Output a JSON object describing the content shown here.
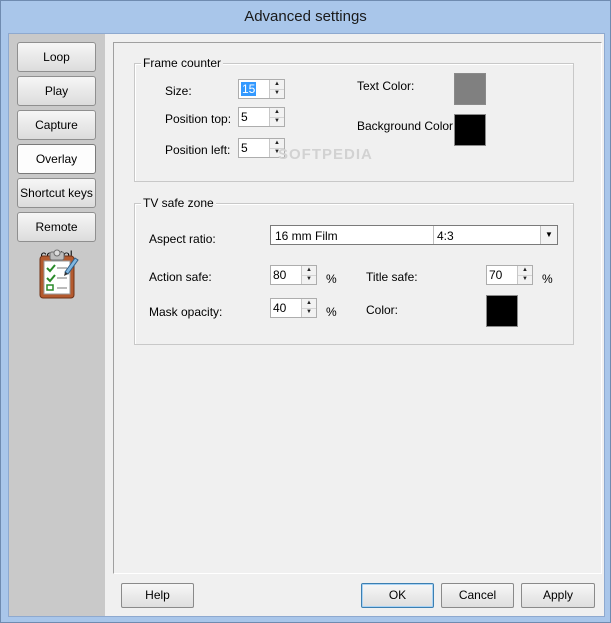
{
  "window": {
    "title": "Advanced settings"
  },
  "nav": {
    "items": [
      {
        "label": "Loop"
      },
      {
        "label": "Play"
      },
      {
        "label": "Capture"
      },
      {
        "label": "Overlay",
        "active": true
      },
      {
        "label": "Shortcut keys"
      },
      {
        "label": "Remote contol"
      }
    ],
    "icon": "clipboard-checklist-icon"
  },
  "frame_counter": {
    "legend": "Frame counter",
    "size": {
      "label": "Size:",
      "value": "15"
    },
    "position_top": {
      "label": "Position top:",
      "value": "5"
    },
    "position_left": {
      "label": "Position left:",
      "value": "5"
    },
    "text_color": {
      "label": "Text Color:",
      "color": "#808080"
    },
    "background_color": {
      "label": "Background Color:",
      "color": "#000000"
    }
  },
  "tv_safe_zone": {
    "legend": "TV safe zone",
    "aspect_ratio": {
      "label": "Aspect ratio:",
      "selected_name": "16 mm Film",
      "selected_ratio": "4:3"
    },
    "action_safe": {
      "label": "Action safe:",
      "value": "80",
      "unit": "%"
    },
    "title_safe": {
      "label": "Title safe:",
      "value": "70",
      "unit": "%"
    },
    "mask_opacity": {
      "label": "Mask opacity:",
      "value": "40",
      "unit": "%"
    },
    "color": {
      "label": "Color:",
      "color": "#000000"
    }
  },
  "buttons": {
    "help": "Help",
    "ok": "OK",
    "cancel": "Cancel",
    "apply": "Apply"
  },
  "watermark": "SOFTPEDIA"
}
